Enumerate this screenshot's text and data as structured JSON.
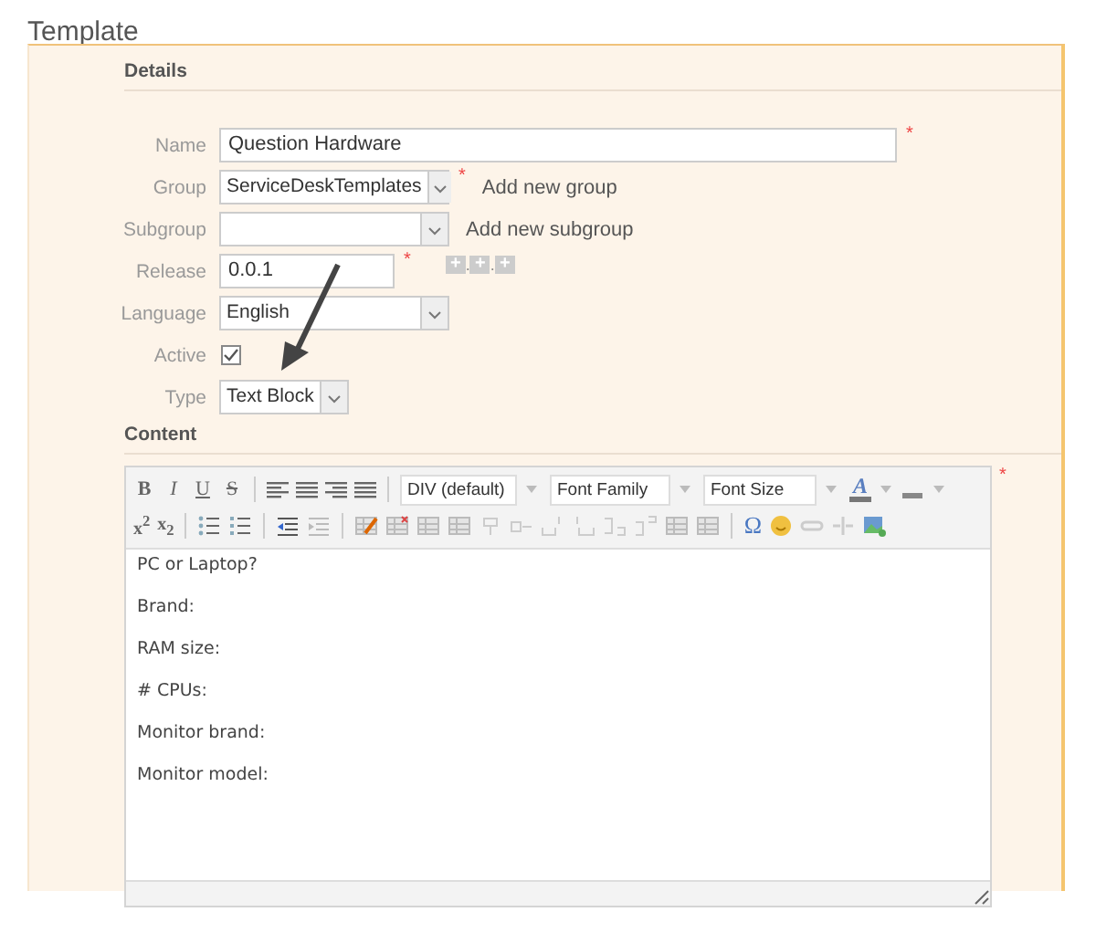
{
  "page": {
    "title": "Template"
  },
  "details": {
    "heading": "Details",
    "fields": [
      {
        "label": "Name",
        "kind": "text",
        "value": "Question Hardware",
        "required_mark": "*"
      },
      {
        "label": "Group",
        "kind": "select",
        "value": "ServiceDeskTemplates",
        "required_mark": "*",
        "link": "Add new group"
      },
      {
        "label": "Subgroup",
        "kind": "select",
        "link": "Add new subgroup"
      },
      {
        "label": "Release",
        "kind": "version",
        "value": "0.0.1",
        "required_mark": "*",
        "version_parts": [
          "+",
          "+",
          "+"
        ],
        "version_separator": "."
      },
      {
        "label": "Language",
        "kind": "select",
        "value": "English"
      },
      {
        "label": "Active",
        "kind": "checkbox",
        "checked": true
      },
      {
        "label": "Type",
        "kind": "small_select",
        "value": "Text Block"
      }
    ]
  },
  "content": {
    "heading": "Content",
    "required_mark": "*",
    "toolbar": {
      "format_buttons": [
        {
          "label": "B",
          "kind": "bold"
        },
        {
          "label": "I",
          "kind": "italic"
        },
        {
          "label": "U",
          "kind": "underline"
        },
        {
          "label": "S",
          "kind": "strike"
        }
      ],
      "dropdowns": [
        "DIV (default)",
        "Font Family",
        "Font Size"
      ],
      "text_color_label": "A",
      "script_buttons": [
        "x$^{2}$",
        "x$_{2}$"
      ],
      "special_char": "Ω"
    },
    "lines": [
      "PC or Laptop?",
      "Brand:",
      "RAM size:",
      "# CPUs:",
      "Monitor brand:",
      "Monitor model:"
    ]
  }
}
